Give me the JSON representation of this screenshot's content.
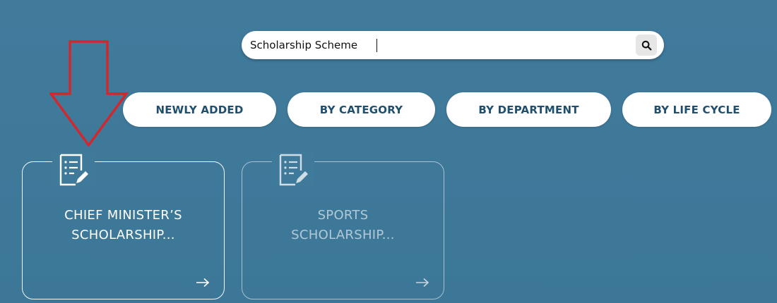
{
  "search": {
    "value": "Scholarship Scheme",
    "icon": "search-icon"
  },
  "filters": [
    {
      "label": "NEWLY ADDED"
    },
    {
      "label": "BY CATEGORY"
    },
    {
      "label": "BY DEPARTMENT"
    },
    {
      "label": "BY LIFE CYCLE"
    }
  ],
  "cards": [
    {
      "title_line1": "CHIEF MINISTER’S",
      "title_line2": "SCHOLARSHIP...",
      "icon": "document-edit-icon",
      "arrow_icon": "arrow-right-icon"
    },
    {
      "title_line1": "SPORTS",
      "title_line2": "SCHOLARSHIP...",
      "icon": "document-edit-icon",
      "arrow_icon": "arrow-right-icon"
    }
  ],
  "colors": {
    "background": "#3f7a9b",
    "filter_text": "#1f4f6d",
    "annotation_arrow": "#d0282e"
  }
}
